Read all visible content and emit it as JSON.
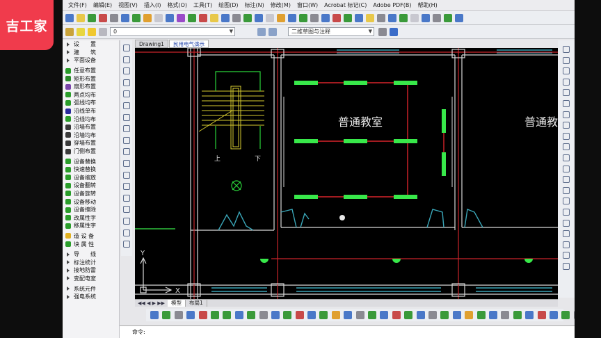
{
  "logo": {
    "text": "吉工家"
  },
  "menubar": {
    "items": [
      "文件(F)",
      "编辑(E)",
      "视图(V)",
      "插入(I)",
      "格式(O)",
      "工具(T)",
      "绘图(D)",
      "标注(N)",
      "修改(M)",
      "窗口(W)",
      "Acrobat 标记(C)",
      "Adobe PDF(B)",
      "帮助(H)"
    ]
  },
  "toolbar": {
    "layer_value": "0",
    "view_value": "二维草图与注释"
  },
  "doc_tabs": [
    "Drawing1",
    "民用电气演示"
  ],
  "active_doc_tab": 1,
  "left_panel": {
    "items": [
      {
        "label": "设　　置",
        "kind": "tri"
      },
      {
        "label": "建　　筑",
        "kind": "tri"
      },
      {
        "label": "平面设备",
        "kind": "tri"
      },
      {
        "label": "任意布置",
        "kind": "icon",
        "color": "#2a9d2a"
      },
      {
        "label": "矩形布置",
        "kind": "icon",
        "color": "#2a8a2a"
      },
      {
        "label": "扇形布置",
        "kind": "icon",
        "color": "#7a44aa"
      },
      {
        "label": "两点均布",
        "kind": "icon",
        "color": "#2a9d2a"
      },
      {
        "label": "弧线均布",
        "kind": "icon",
        "color": "#2a9d2a"
      },
      {
        "label": "沿线单布",
        "kind": "icon",
        "color": "#2a2a9d"
      },
      {
        "label": "沿线均布",
        "kind": "icon",
        "color": "#2a9d2a"
      },
      {
        "label": "沿墙布置",
        "kind": "icon",
        "color": "#3a3a3a"
      },
      {
        "label": "沿墙均布",
        "kind": "icon",
        "color": "#3a3a3a"
      },
      {
        "label": "穿墙布置",
        "kind": "icon",
        "color": "#3a3a3a"
      },
      {
        "label": "门侧布置",
        "kind": "icon",
        "color": "#3a3a3a"
      },
      {
        "label": "设备替换",
        "kind": "icon",
        "color": "#2a9d2a"
      },
      {
        "label": "快速替换",
        "kind": "icon",
        "color": "#2a9d2a"
      },
      {
        "label": "设备缩放",
        "kind": "icon",
        "color": "#2a9d2a"
      },
      {
        "label": "设备翻转",
        "kind": "icon",
        "color": "#2a9d2a"
      },
      {
        "label": "设备旋转",
        "kind": "icon",
        "color": "#2a9d2a"
      },
      {
        "label": "设备移动",
        "kind": "icon",
        "color": "#2a9d2a"
      },
      {
        "label": "设备擦除",
        "kind": "icon",
        "color": "#2a9d2a"
      },
      {
        "label": "改属性字",
        "kind": "icon",
        "color": "#2a9d2a"
      },
      {
        "label": "移属性字",
        "kind": "icon",
        "color": "#2a9d2a"
      },
      {
        "label": "造 设 备",
        "kind": "icon",
        "color": "#e0b020"
      },
      {
        "label": "块 属 性",
        "kind": "icon",
        "color": "#2a9d2a"
      },
      {
        "label": "导　　线",
        "kind": "tri"
      },
      {
        "label": "标注统计",
        "kind": "tri"
      },
      {
        "label": "接地防雷",
        "kind": "tri"
      },
      {
        "label": "变配电室",
        "kind": "tri"
      },
      {
        "label": "系统元件",
        "kind": "tri"
      },
      {
        "label": "强电系统",
        "kind": "tri"
      }
    ]
  },
  "drawing": {
    "room_label_1": "普通教室",
    "room_label_2": "普通教",
    "stair_up": "上",
    "stair_down": "下",
    "axis_x": "X",
    "axis_y": "Y"
  },
  "layout_tabs": [
    "模型",
    "布局1"
  ],
  "command_line": {
    "prompt": "命令:"
  }
}
